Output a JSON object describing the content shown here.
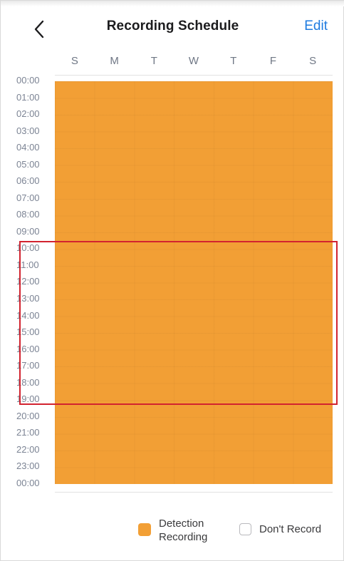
{
  "header": {
    "title": "Recording Schedule",
    "edit_label": "Edit",
    "back_icon": "chevron-left-icon"
  },
  "days": [
    "S",
    "M",
    "T",
    "W",
    "T",
    "F",
    "S"
  ],
  "hours": [
    "00:00",
    "01:00",
    "02:00",
    "03:00",
    "04:00",
    "05:00",
    "06:00",
    "07:00",
    "08:00",
    "09:00",
    "10:00",
    "11:00",
    "12:00",
    "13:00",
    "14:00",
    "15:00",
    "16:00",
    "17:00",
    "18:00",
    "19:00",
    "20:00",
    "21:00",
    "22:00",
    "23:00",
    "00:00"
  ],
  "legend": {
    "detection_label": "Detection Recording",
    "none_label": "Don't Record"
  },
  "colors": {
    "detection": "#f29f35",
    "accent": "#1e7be0",
    "highlight": "#d2232f"
  }
}
